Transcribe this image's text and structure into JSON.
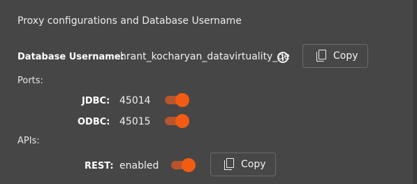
{
  "title": "Proxy configurations and Database Username",
  "database_username": {
    "label": "Database Username:",
    "value": "hrant_kocharyan_datavirtuality_de",
    "info_icon": "info-icon",
    "copy_label": "Copy",
    "copy_icon": "copy-icon"
  },
  "ports": {
    "section_label": "Ports:",
    "jdbc": {
      "label": "JDBC:",
      "value": "45014",
      "enabled": true
    },
    "odbc": {
      "label": "ODBC:",
      "value": "45015",
      "enabled": true
    }
  },
  "apis": {
    "section_label": "APIs:",
    "rest": {
      "label": "REST:",
      "value": "enabled",
      "enabled": true,
      "copy_label": "Copy",
      "copy_icon": "copy-icon"
    }
  },
  "colors": {
    "background": "#464646",
    "toggle_knob": "#f25b12",
    "toggle_track": "#b8552c",
    "button_border": "#6b6b6b"
  }
}
